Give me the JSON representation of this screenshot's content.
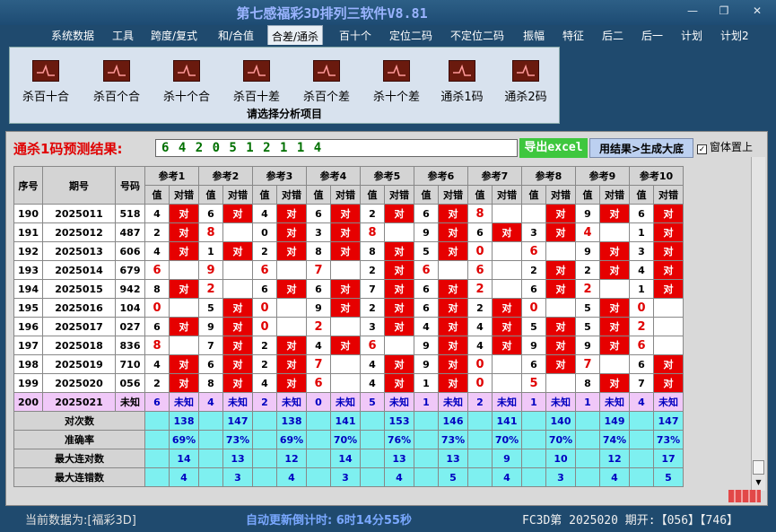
{
  "app": {
    "title": "第七感福彩3D排列三软件V8.81"
  },
  "window_controls": {
    "minimize": "—",
    "restore": "❐",
    "close": "✕"
  },
  "menu": [
    "系统数据",
    "工具",
    "跨度/复式",
    "和/合值",
    "合差/通杀",
    "百十个",
    "定位二码",
    "不定位二码",
    "振幅",
    "特征",
    "后二",
    "后一",
    "计划",
    "计划2"
  ],
  "ribbon": {
    "caption": "请选择分析项目",
    "buttons": [
      "杀百十合",
      "杀百个合",
      "杀十个合",
      "杀百十差",
      "杀百个差",
      "杀十个差",
      "通杀1码",
      "通杀2码"
    ]
  },
  "prediction": {
    "label": "通杀1码预测结果:",
    "value": "6 4 2 0 5 1 2 1 1 4",
    "export": "导出excel",
    "generate": "用结果>生成大底",
    "topmost": "窗体置上"
  },
  "table": {
    "headers": {
      "seq": "序号",
      "issue": "期号",
      "number": "号码",
      "refs": [
        "参考1",
        "参考2",
        "参考3",
        "参考4",
        "参考5",
        "参考6",
        "参考7",
        "参考8",
        "参考9",
        "参考10"
      ],
      "value": "值",
      "result": "对错"
    },
    "rows": [
      {
        "seq": "190",
        "issue": "2025011",
        "number": "518",
        "vals": [
          "4",
          "6",
          "4",
          "6",
          "2",
          "6",
          "8",
          "",
          "9",
          "6"
        ],
        "res": [
          "对",
          "对",
          "对",
          "对",
          "对",
          "对",
          "",
          "对",
          "对",
          "对"
        ]
      },
      {
        "seq": "191",
        "issue": "2025012",
        "number": "487",
        "vals": [
          "2",
          "8",
          "0",
          "3",
          "8",
          "9",
          "6",
          "3",
          "4",
          "1"
        ],
        "res": [
          "对",
          "",
          "对",
          "对",
          "",
          "对",
          "对",
          "对",
          "",
          "对"
        ]
      },
      {
        "seq": "192",
        "issue": "2025013",
        "number": "606",
        "vals": [
          "4",
          "1",
          "2",
          "8",
          "8",
          "5",
          "0",
          "6",
          "9",
          "3"
        ],
        "res": [
          "对",
          "对",
          "对",
          "对",
          "对",
          "对",
          "",
          "",
          "对",
          "对"
        ]
      },
      {
        "seq": "193",
        "issue": "2025014",
        "number": "679",
        "vals": [
          "6",
          "9",
          "6",
          "7",
          "2",
          "6",
          "6",
          "2",
          "2",
          "4"
        ],
        "res": [
          "",
          "",
          "",
          "",
          "对",
          "",
          "",
          "对",
          "对",
          "对"
        ]
      },
      {
        "seq": "194",
        "issue": "2025015",
        "number": "942",
        "vals": [
          "8",
          "2",
          "6",
          "6",
          "7",
          "6",
          "2",
          "6",
          "2",
          "1"
        ],
        "res": [
          "对",
          "",
          "对",
          "对",
          "对",
          "对",
          "",
          "对",
          "",
          "对"
        ]
      },
      {
        "seq": "195",
        "issue": "2025016",
        "number": "104",
        "vals": [
          "0",
          "5",
          "0",
          "9",
          "2",
          "6",
          "2",
          "0",
          "5",
          "0"
        ],
        "res": [
          "",
          "对",
          "",
          "对",
          "对",
          "对",
          "对",
          "",
          "对",
          ""
        ]
      },
      {
        "seq": "196",
        "issue": "2025017",
        "number": "027",
        "vals": [
          "6",
          "9",
          "0",
          "2",
          "3",
          "4",
          "4",
          "5",
          "5",
          "2"
        ],
        "res": [
          "对",
          "对",
          "",
          "",
          "对",
          "对",
          "对",
          "对",
          "对",
          ""
        ]
      },
      {
        "seq": "197",
        "issue": "2025018",
        "number": "836",
        "vals": [
          "8",
          "7",
          "2",
          "4",
          "6",
          "9",
          "4",
          "9",
          "9",
          "6"
        ],
        "res": [
          "",
          "对",
          "对",
          "对",
          "",
          "对",
          "对",
          "对",
          "对",
          ""
        ]
      },
      {
        "seq": "198",
        "issue": "2025019",
        "number": "710",
        "vals": [
          "4",
          "6",
          "2",
          "7",
          "4",
          "9",
          "0",
          "6",
          "7",
          "6"
        ],
        "res": [
          "对",
          "对",
          "对",
          "",
          "对",
          "对",
          "",
          "对",
          "",
          "对"
        ]
      },
      {
        "seq": "199",
        "issue": "2025020",
        "number": "056",
        "vals": [
          "2",
          "8",
          "4",
          "6",
          "4",
          "1",
          "0",
          "5",
          "8",
          "7"
        ],
        "res": [
          "对",
          "对",
          "对",
          "",
          "对",
          "对",
          "",
          "",
          "对",
          "对"
        ]
      }
    ],
    "future": {
      "seq": "200",
      "issue": "2025021",
      "number": "未知",
      "vals": [
        "6",
        "4",
        "2",
        "0",
        "5",
        "1",
        "2",
        "1",
        "1",
        "4"
      ],
      "unknown": "未知"
    },
    "stats": [
      {
        "label": "对次数",
        "values": [
          "138",
          "147",
          "138",
          "141",
          "153",
          "146",
          "141",
          "140",
          "149",
          "147"
        ]
      },
      {
        "label": "准确率",
        "values": [
          "69%",
          "73%",
          "69%",
          "70%",
          "76%",
          "73%",
          "70%",
          "70%",
          "74%",
          "73%"
        ]
      },
      {
        "label": "最大连对数",
        "values": [
          "14",
          "13",
          "12",
          "14",
          "13",
          "13",
          "9",
          "10",
          "12",
          "17"
        ]
      },
      {
        "label": "最大连错数",
        "values": [
          "4",
          "3",
          "4",
          "3",
          "4",
          "5",
          "4",
          "3",
          "4",
          "5"
        ]
      }
    ]
  },
  "status": {
    "current": "当前数据为:[福彩3D]",
    "countdown": "自动更新倒计时:   6时14分55秒",
    "issue": "FC3D第 2025020 期开:【056】【746】"
  }
}
